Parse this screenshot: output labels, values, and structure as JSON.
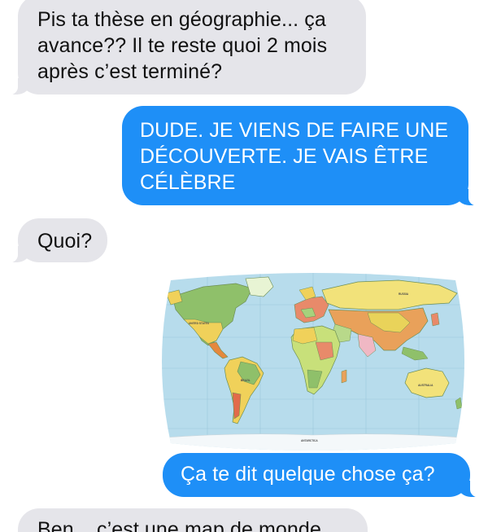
{
  "conversation": {
    "messages": [
      {
        "sender": "other",
        "text": "Pis ta thèse en géographie... ça\navance?? Il te reste quoi 2 mois\naprès c’est terminé?"
      },
      {
        "sender": "me",
        "text": "DUDE. JE VIENS DE FAIRE UNE\nDÉCOUVERTE. JE VAIS ÊTRE\nCÉLÈBRE"
      },
      {
        "sender": "other",
        "text": "Quoi?"
      },
      {
        "sender": "me",
        "type": "image",
        "image_content": "world map"
      },
      {
        "sender": "me",
        "text": "Ça te dit quelque chose ça?"
      },
      {
        "sender": "other",
        "text": "Ben... c’est une map de monde"
      }
    ]
  },
  "colors": {
    "incoming_bubble": "#e5e5ea",
    "outgoing_bubble": "#1e8ff7",
    "ocean": "#b7dcec"
  },
  "map_labels": {
    "russia": "RUSSIA",
    "united_states": "UNITED STATES",
    "brazil": "BRAZIL",
    "australia": "AUSTRALIA",
    "antarctica": "ANTARCTICA"
  }
}
